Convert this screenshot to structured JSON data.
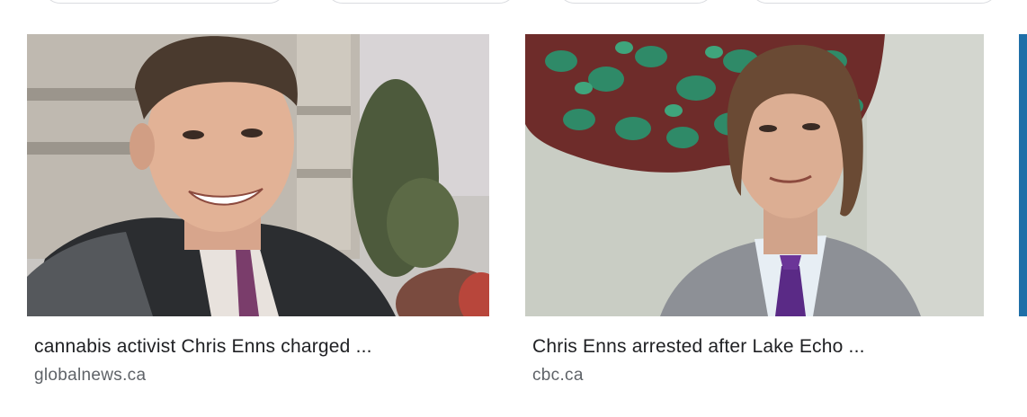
{
  "results": [
    {
      "title": "cannabis activist Chris Enns charged ...",
      "source": "globalnews.ca"
    },
    {
      "title": "Chris Enns arrested after Lake Echo ...",
      "source": "cbc.ca"
    }
  ],
  "colors": {
    "title_text": "#202124",
    "source_text": "#5f6368",
    "chip_border": "#dadce0",
    "edge_card": "#1f6fa8"
  }
}
